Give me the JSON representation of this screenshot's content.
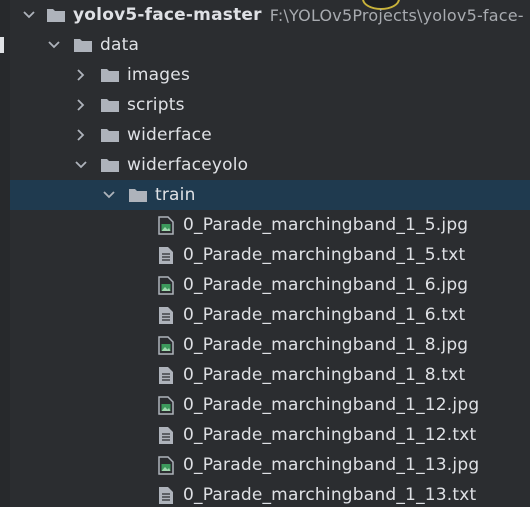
{
  "project": {
    "name": "yolov5-face-master",
    "path": "F:\\YOLOv5Projects\\yolov5-face-"
  },
  "tree": {
    "data": "data",
    "folders": [
      "images",
      "scripts",
      "widerface",
      "widerfaceyolo"
    ],
    "train": "train",
    "files": [
      {
        "name": "0_Parade_marchingband_1_5.jpg",
        "type": "image"
      },
      {
        "name": "0_Parade_marchingband_1_5.txt",
        "type": "text"
      },
      {
        "name": "0_Parade_marchingband_1_6.jpg",
        "type": "image"
      },
      {
        "name": "0_Parade_marchingband_1_6.txt",
        "type": "text"
      },
      {
        "name": "0_Parade_marchingband_1_8.jpg",
        "type": "image"
      },
      {
        "name": "0_Parade_marchingband_1_8.txt",
        "type": "text"
      },
      {
        "name": "0_Parade_marchingband_1_12.jpg",
        "type": "image"
      },
      {
        "name": "0_Parade_marchingband_1_12.txt",
        "type": "text"
      },
      {
        "name": "0_Parade_marchingband_1_13.jpg",
        "type": "image"
      },
      {
        "name": "0_Parade_marchingband_1_13.txt",
        "type": "text"
      }
    ]
  },
  "icons": {
    "expanded": "chevron-down-icon",
    "collapsed": "chevron-right-icon",
    "folder": "folder-icon",
    "image_file": "image-file-icon",
    "text_file": "text-file-icon"
  },
  "colors": {
    "background": "#2b2d30",
    "selection": "#1f3a4f",
    "text": "#dfe1e5",
    "path_text": "#a8abb0",
    "folder": "#aeb3bb",
    "image_icon_accent": "#3d9a5d"
  }
}
